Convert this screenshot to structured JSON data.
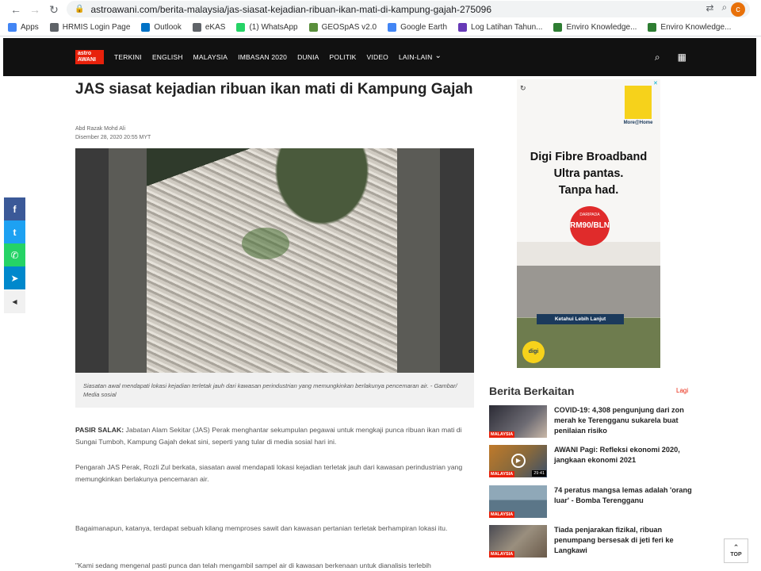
{
  "browser": {
    "url": "astroawani.com/berita-malaysia/jas-siasat-kejadian-ribuan-ikan-mati-di-kampung-gajah-275096",
    "avatar_letter": "c",
    "bookmarks": [
      {
        "label": "Apps",
        "color": "#4285f4"
      },
      {
        "label": "HRMIS Login Page",
        "color": "#5f6368"
      },
      {
        "label": "Outlook",
        "color": "#0072c6"
      },
      {
        "label": "eKAS",
        "color": "#5f6368"
      },
      {
        "label": "(1) WhatsApp",
        "color": "#25d366"
      },
      {
        "label": "GEOSpAS v2.0",
        "color": "#5a8f3c"
      },
      {
        "label": "Google Earth",
        "color": "#4285f4"
      },
      {
        "label": "Log Latihan Tahun...",
        "color": "#673ab7"
      },
      {
        "label": "Enviro Knowledge...",
        "color": "#2e7d32"
      },
      {
        "label": "Enviro Knowledge...",
        "color": "#2e7d32"
      }
    ]
  },
  "site": {
    "logo_line1": "astro",
    "logo_line2": "AWANI",
    "nav": [
      "TERKINI",
      "ENGLISH",
      "MALAYSIA",
      "IMBASAN 2020",
      "DUNIA",
      "POLITIK",
      "VIDEO",
      "LAIN-LAIN"
    ]
  },
  "article": {
    "title": "JAS siasat kejadian ribuan ikan mati di Kampung Gajah",
    "author": "Abd Razak Mohd Ali",
    "date": "Disember 28, 2020 20:55 MYT",
    "caption": "Siasatan awal mendapati lokasi kejadian terletak jauh dari kawasan perindustrian yang memungkinkan berlakunya pencemaran air. - Gambar/ Media sosial",
    "p1_lead": "PASIR SALAK:",
    "p1": " Jabatan Alam Sekitar (JAS) Perak menghantar sekumpulan pegawai untuk mengkaji punca ribuan ikan mati di Sungai Tumboh, Kampung Gajah dekat sini, seperti yang tular di media sosial hari ini.",
    "p2": "Pengarah JAS Perak, Rozli Zul berkata, siasatan awal mendapati lokasi kejadian terletak jauh dari kawasan perindustrian yang memungkinkan berlakunya pencemaran air.",
    "p3": "Bagaimanapun, katanya, terdapat sebuah kilang memproses sawit dan kawasan pertanian terletak berhampiran lokasi itu.",
    "p4": "\"Kami sedang mengenal pasti punca dan telah mengambil sampel air di kawasan berkenaan untuk dianalisis terlebih"
  },
  "ad": {
    "brand": "More@Home",
    "headline1": "Digi Fibre Broadband",
    "headline2": "Ultra pantas.",
    "headline3": "Tanpa had.",
    "price_small": "DARIPADA",
    "price": "RM90/BLN",
    "cta": "Ketahui Lebih Lanjut",
    "logo": "digi"
  },
  "related": {
    "heading": "Berita Berkaitan",
    "more": "Lagi",
    "items": [
      {
        "tag": "MALAYSIA",
        "title": "COVID-19: 4,308 pengunjung dari zon merah ke Terengganu sukarela buat penilaian risiko",
        "duration": ""
      },
      {
        "tag": "MALAYSIA",
        "title": "AWANI Pagi: Refleksi ekonomi 2020, jangkaan ekonomi 2021",
        "duration": "29:41"
      },
      {
        "tag": "MALAYSIA",
        "title": "74 peratus mangsa lemas adalah 'orang luar' - Bomba Terengganu",
        "duration": ""
      },
      {
        "tag": "MALAYSIA",
        "title": "Tiada penjarakan fizikal, ribuan penumpang bersesak di jeti feri ke Langkawi",
        "duration": ""
      }
    ]
  },
  "share": [
    {
      "icon": "facebook-icon",
      "glyph": "f",
      "color": "#3b5998"
    },
    {
      "icon": "twitter-icon",
      "glyph": "t",
      "color": "#1da1f2"
    },
    {
      "icon": "whatsapp-icon",
      "glyph": "✆",
      "color": "#25d366"
    },
    {
      "icon": "telegram-icon",
      "glyph": "➤",
      "color": "#0088cc"
    }
  ],
  "top_button": "TOP"
}
